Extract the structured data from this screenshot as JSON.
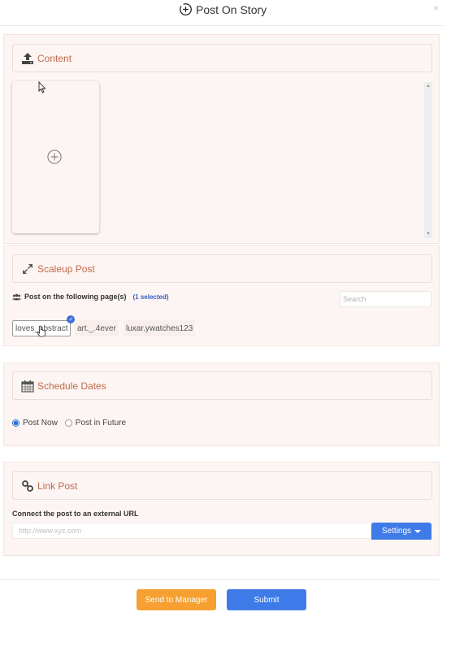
{
  "modal": {
    "title": "Post On Story",
    "title_icon": "circle-plus-icon",
    "close_label": "×"
  },
  "content": {
    "title": "Content",
    "icon": "upload-icon",
    "add_media_icon": "circle-plus-icon"
  },
  "scaleup": {
    "title": "Scaleup Post",
    "icon": "expand-icon",
    "pages_label": "Post on the following page(s)",
    "selected_count": "(1 selected)",
    "search_placeholder": "Search",
    "pages": [
      {
        "name": "loves_abstract",
        "selected": true
      },
      {
        "name": "art._.4ever",
        "selected": false
      },
      {
        "name": "luxar.ywatches123",
        "selected": false
      }
    ]
  },
  "schedule": {
    "title": "Schedule Dates",
    "icon": "calendar-icon",
    "options": [
      {
        "label": "Post Now",
        "checked": true
      },
      {
        "label": "Post in Future",
        "checked": false
      }
    ]
  },
  "link": {
    "title": "Link Post",
    "icon": "link-icon",
    "url_label": "Connect the post to an external URL",
    "url_placeholder": "http://www.xyz.com",
    "url_value": "",
    "settings_label": "Settings"
  },
  "footer": {
    "send_to_manager_label": "Send to Manager",
    "submit_label": "Submit"
  },
  "colors": {
    "accent_blue": "#3f7be8",
    "accent_orange": "#f7a032",
    "section_title": "#c0694a",
    "panel_bg": "#fdf5f3"
  }
}
